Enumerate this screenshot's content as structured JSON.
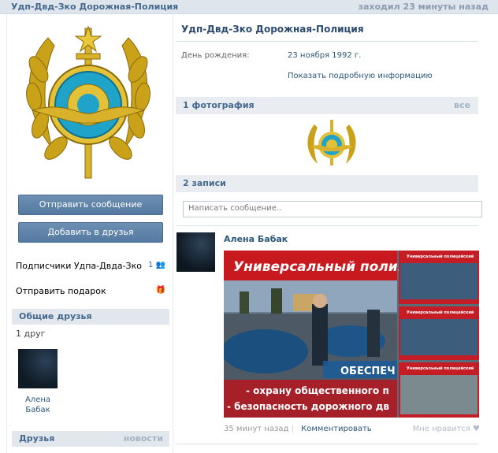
{
  "header": {
    "name": "Удп-Двд-Зко Дорожная-Полиция",
    "last_seen": "заходил 23 минуты назад"
  },
  "left": {
    "send_message": "Отправить сообщение",
    "add_friend": "Добавить в друзья",
    "subscribers_label": "Подписчики Удпа-Двда-Зко",
    "subscribers_count": "1",
    "send_gift": "Отправить подарок",
    "common_friends_title": "Общие друзья",
    "common_friends_count": "1 друг",
    "friend_name": "Алена Бабак",
    "friends_title": "Друзья",
    "friends_more": "новости"
  },
  "profile": {
    "title": "Удп-Двд-Зко Дорожная-Полиция",
    "birthday_label": "День рождения:",
    "birthday_value": "23 ноября 1992 г.",
    "show_more": "Показать подробную информацию"
  },
  "photos": {
    "title": "1 фотография",
    "all_link": "все"
  },
  "wall": {
    "title": "2 записи",
    "placeholder": "Написать сообщение..",
    "post": {
      "author": "Алена Бабак",
      "image_banner": "Универсальный полицейс",
      "image_text_line1": "ОБЕСПЕЧ",
      "image_text_line2": "- охрану общественного п",
      "image_text_line3": "- безопасность дорожного дв",
      "side_caption": "Универсальный полицейский",
      "time": "35 минут назад",
      "comment": "Комментировать",
      "like": "Мне нравится"
    }
  },
  "colors": {
    "link": "#2b587a",
    "header_bg": "#dfe5ec",
    "button": "#5479a0",
    "section_bg": "#e1e7ed"
  }
}
